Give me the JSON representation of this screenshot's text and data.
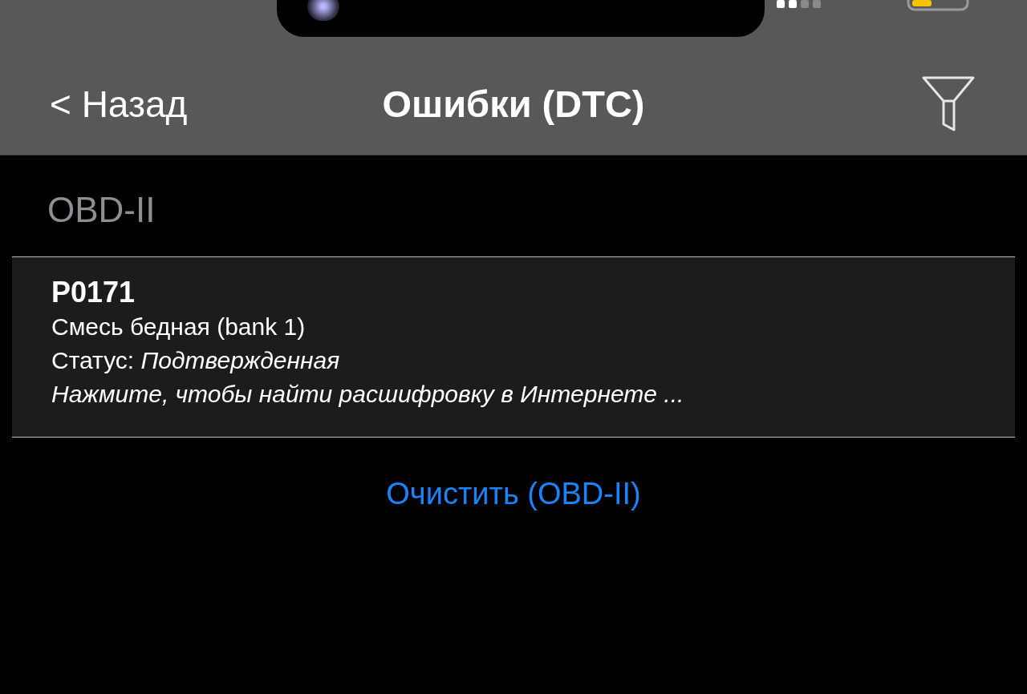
{
  "nav": {
    "back": "< Назад",
    "title": "Ошибки (DTC)"
  },
  "section": {
    "title": "OBD-II",
    "items": [
      {
        "code": "P0171",
        "description": "Смесь бедная (bank 1)",
        "status_label": "Статус:",
        "status": "Подтвержденная",
        "hint": "Нажмите, чтобы найти расшифровку в Интернете ..."
      }
    ]
  },
  "clear_button": "Очистить (OBD-II)"
}
